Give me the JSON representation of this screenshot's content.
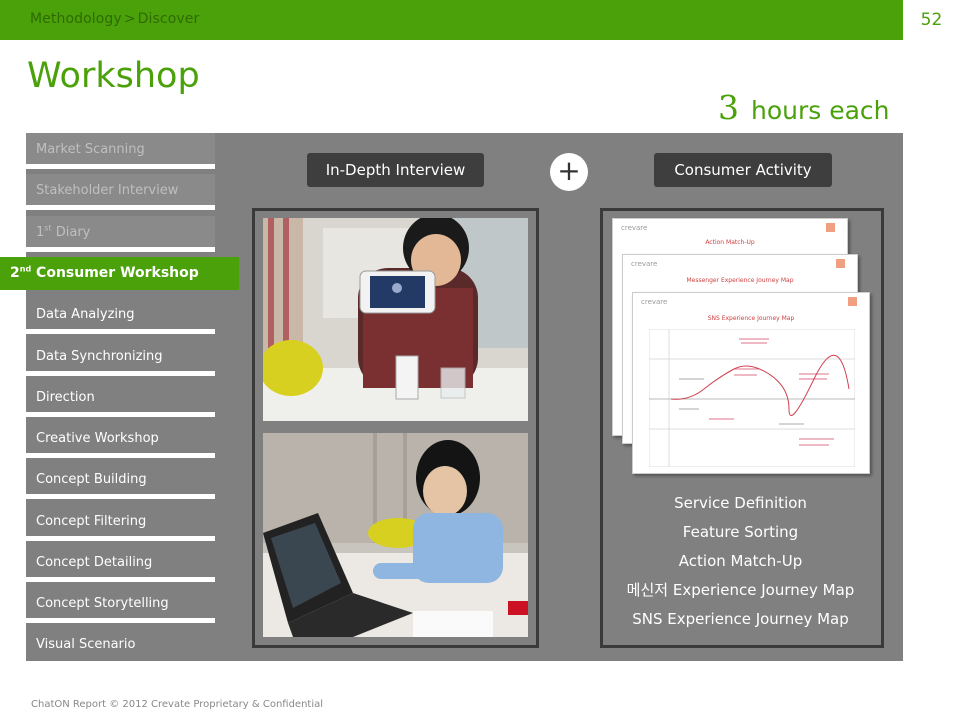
{
  "header": {
    "breadcrumb": [
      "Methodology",
      "Discover"
    ],
    "breadcrumb_separator": ">",
    "page_number": "52"
  },
  "title": "Workshop",
  "duration": {
    "number": "3",
    "unit": "hours each"
  },
  "sidebar": {
    "items": [
      {
        "label": "Market Scanning",
        "state": "dim"
      },
      {
        "label": "Stakeholder Interview",
        "state": "dim"
      },
      {
        "label": "1",
        "sup": "st",
        "rest": " Diary",
        "state": "dim"
      },
      {
        "label": "2",
        "sup": "nd",
        "rest": " Consumer Workshop",
        "state": "active"
      },
      {
        "label": "Data Analyzing",
        "state": "normal"
      },
      {
        "label": "Data Synchronizing",
        "state": "normal"
      },
      {
        "label": "Direction",
        "state": "normal"
      },
      {
        "label": "Creative Workshop",
        "state": "normal"
      },
      {
        "label": "Concept Building",
        "state": "normal"
      },
      {
        "label": "Concept Filtering",
        "state": "normal"
      },
      {
        "label": "Concept Detailing",
        "state": "normal"
      },
      {
        "label": "Concept Storytelling",
        "state": "normal"
      },
      {
        "label": "Visual Scenario",
        "state": "normal"
      }
    ]
  },
  "center": {
    "left_pill": "In-Depth Interview",
    "plus": "+",
    "right_pill": "Consumer Activity"
  },
  "sheets": [
    {
      "brand": "crevare",
      "title": "Action Match-Up"
    },
    {
      "brand": "crevare",
      "title": "Messenger Experience Journey Map"
    },
    {
      "brand": "crevare",
      "title": "SNS Experience Journey Map"
    }
  ],
  "activities": [
    "Service Definition",
    "Feature Sorting",
    "Action Match-Up",
    "메신저 Experience Journey Map",
    "SNS Experience Journey Map"
  ],
  "footer": "ChatON Report © 2012 Crevate Proprietary & Confidential",
  "colors": {
    "accent": "#4aa10a",
    "panel": "#808080",
    "pill": "#3e3e3e"
  }
}
